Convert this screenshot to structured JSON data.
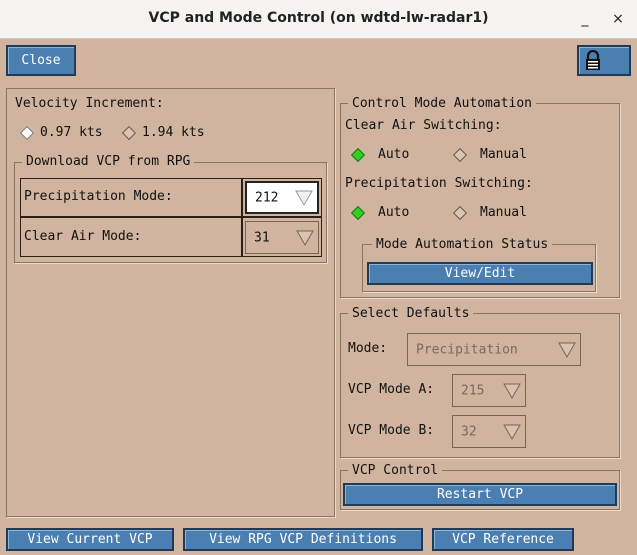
{
  "window": {
    "title": "VCP and Mode Control (on wdtd-lw-radar1)",
    "minimize": "_",
    "close": "×"
  },
  "toolbar": {
    "close_label": "Close"
  },
  "velocity": {
    "label": "Velocity Increment:",
    "option1": "0.97 kts",
    "option2": "1.94 kts"
  },
  "download": {
    "legend": "Download VCP from RPG",
    "precip_label": "Precipitation Mode:",
    "precip_value": "212",
    "clear_label": "Clear Air Mode:",
    "clear_value": "31"
  },
  "automation": {
    "legend": "Control Mode Automation",
    "clear_switch_label": "Clear Air Switching:",
    "precip_switch_label": "Precipitation Switching:",
    "auto": "Auto",
    "manual": "Manual",
    "status_legend": "Mode Automation Status",
    "view_edit": "View/Edit"
  },
  "defaults": {
    "legend": "Select Defaults",
    "mode_label": "Mode:",
    "mode_value": "Precipitation",
    "vcp_a_label": "VCP Mode A:",
    "vcp_a_value": "215",
    "vcp_b_label": "VCP Mode B:",
    "vcp_b_value": "32"
  },
  "vcp_control": {
    "legend": "VCP Control",
    "restart": "Restart VCP"
  },
  "footer": {
    "view_current": "View Current VCP",
    "view_defs": "View RPG VCP Definitions",
    "reference": "VCP Reference"
  },
  "colors": {
    "accent": "#4b7fb1",
    "background": "#d0b49f",
    "radio_on": "#2fd31e"
  }
}
